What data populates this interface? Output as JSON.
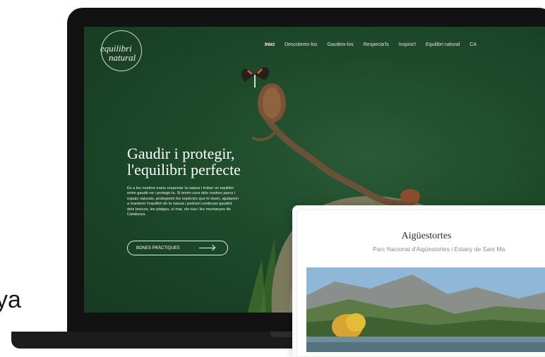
{
  "edge_text": "ya",
  "logo": {
    "line1": "equilibri",
    "line2": "natural"
  },
  "nav": {
    "items": [
      "Inici",
      "Descobreix-los",
      "Gaudeix-los",
      "Respecta'ls",
      "Inspira't",
      "Equilibri natural",
      "CA"
    ]
  },
  "hero": {
    "title_line1": "Gaudir i protegir,",
    "title_line2": "l'equilibri perfecte",
    "body": "És a les nostres mans respectar la natura i trobar un equilibri entre gaudir-ne i protegir-la. Si tenim cura dels nostres parcs i espais naturals, protegirem les espècies que hi viuen, ajudarem a mantenir l'equilibri de la natura i podrem continuar gaudint dels boscos, les platges, el mar, els rius i les muntanyes de Catalunya.",
    "cta_label": "BONES PRÀCTIQUES"
  },
  "card": {
    "title": "Aigüestortes",
    "subtitle": "Parc Nacional d'Aigüestortes i Estany de Sant Ma"
  },
  "colors": {
    "hero_bg": "#1e4a2a",
    "laptop": "#121212",
    "card_bg": "#ffffff"
  }
}
